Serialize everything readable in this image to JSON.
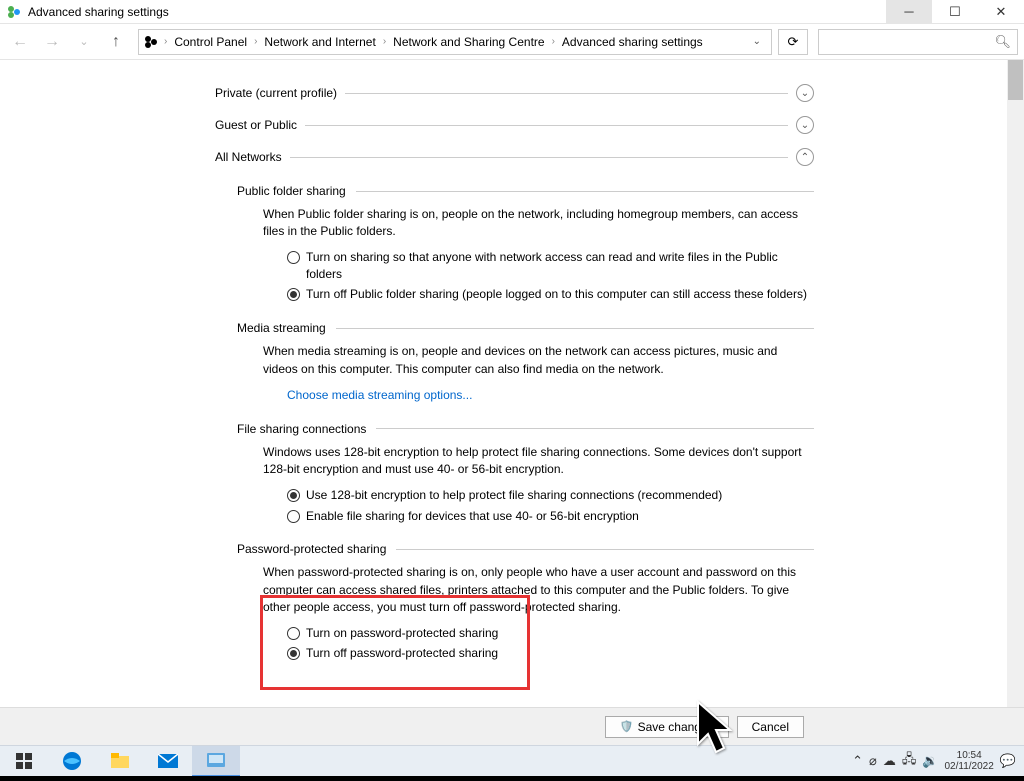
{
  "window": {
    "title": "Advanced sharing settings"
  },
  "breadcrumb": {
    "items": [
      "Control Panel",
      "Network and Internet",
      "Network and Sharing Centre",
      "Advanced sharing settings"
    ]
  },
  "sections": {
    "private": {
      "label": "Private (current profile)"
    },
    "guest": {
      "label": "Guest or Public"
    },
    "all": {
      "label": "All Networks"
    }
  },
  "public_folder": {
    "heading": "Public folder sharing",
    "desc": "When Public folder sharing is on, people on the network, including homegroup members, can access files in the Public folders.",
    "opt_on": "Turn on sharing so that anyone with network access can read and write files in the Public folders",
    "opt_off": "Turn off Public folder sharing (people logged on to this computer can still access these folders)"
  },
  "media": {
    "heading": "Media streaming",
    "desc": "When media streaming is on, people and devices on the network can access pictures, music and videos on this computer. This computer can also find media on the network.",
    "link": "Choose media streaming options..."
  },
  "encryption": {
    "heading": "File sharing connections",
    "desc": "Windows uses 128-bit encryption to help protect file sharing connections. Some devices don't support 128-bit encryption and must use 40- or 56-bit encryption.",
    "opt_128": "Use 128-bit encryption to help protect file sharing connections (recommended)",
    "opt_40": "Enable file sharing for devices that use 40- or 56-bit encryption"
  },
  "password": {
    "heading": "Password-protected sharing",
    "desc": "When password-protected sharing is on, only people who have a user account and password on this computer can access shared files, printers attached to this computer and the Public folders. To give other people access, you must turn off password-protected sharing.",
    "opt_on": "Turn on password-protected sharing",
    "opt_off": "Turn off password-protected sharing"
  },
  "buttons": {
    "save": "Save changes",
    "cancel": "Cancel"
  },
  "clock": {
    "time": "10:54",
    "date": "02/11/2022"
  }
}
